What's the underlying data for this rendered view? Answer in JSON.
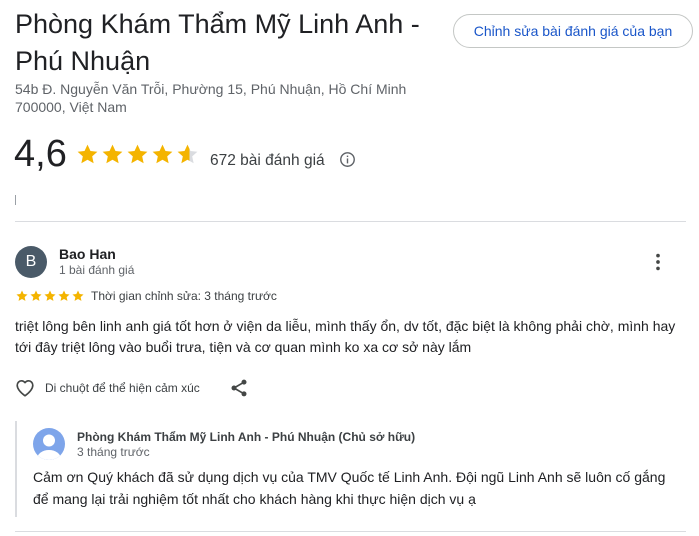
{
  "place": {
    "title": "Phòng Khám Thẩm Mỹ Linh Anh - Phú Nhuận",
    "address": "54b Đ. Nguyễn Văn Trỗi, Phường 15, Phú Nhuận, Hồ Chí Minh 700000, Việt Nam",
    "edit_review_label": "Chỉnh sửa bài đánh giá của bạn"
  },
  "rating": {
    "value": "4,6",
    "stars": 4.6,
    "count_label": "672 bài đánh giá",
    "star_color": "#f4b400",
    "star_empty_color": "#dadce0"
  },
  "review": {
    "avatar_initial": "B",
    "avatar_color": "#4a5a68",
    "author": "Bao Han",
    "author_meta": "1 bài đánh giá",
    "stars": 5,
    "edited_label": "Thời gian chỉnh sửa: 3 tháng trước",
    "text": "triệt lông bên linh anh giá tốt hơn ở viện da liễu, mình thấy ổn, dv tốt, đặc biệt là không phải chờ, mình hay tới đây triệt lông vào buổi trưa, tiện và cơ quan mình ko xa cơ sở này lắm",
    "react_label": "Di chuột để thể hiện cảm xúc",
    "icons": {
      "react": "heart-outline-icon",
      "share": "share-icon",
      "more": "more-vert-icon"
    }
  },
  "owner_reply": {
    "author": "Phòng Khám Thẩm Mỹ Linh Anh - Phú Nhuận (Chủ sở hữu)",
    "time": "3 tháng trước",
    "text": "Cảm ơn Quý khách đã sử dụng dịch vụ của TMV Quốc tế Linh Anh. Đội ngũ Linh Anh sẽ luôn cố gắng để mang lại trải nghiệm tốt nhất cho khách hàng khi thực hiện dịch vụ ạ",
    "avatar_icon": "person-avatar-icon",
    "avatar_color": "#7ea5ea"
  }
}
